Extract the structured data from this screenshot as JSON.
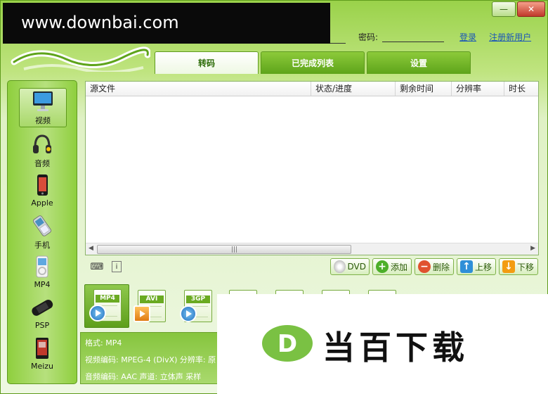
{
  "window": {
    "minimize_glyph": "—",
    "close_glyph": "✕"
  },
  "watermark": {
    "text": "www.downbai.com"
  },
  "login": {
    "password_label": "密码:",
    "login_link": "登录",
    "register_link": "注册新用户"
  },
  "tabs": [
    {
      "label": "转码",
      "active": true
    },
    {
      "label": "已完成列表",
      "active": false
    },
    {
      "label": "设置",
      "active": false
    }
  ],
  "sidebar": {
    "items": [
      {
        "label": "视频",
        "icon": "monitor-icon",
        "active": true
      },
      {
        "label": "音频",
        "icon": "headphones-icon"
      },
      {
        "label": "Apple",
        "icon": "iphone-icon"
      },
      {
        "label": "手机",
        "icon": "mobile-phone-icon"
      },
      {
        "label": "MP4",
        "icon": "mp4-player-icon"
      },
      {
        "label": "PSP",
        "icon": "psp-icon"
      },
      {
        "label": "Meizu",
        "icon": "meizu-player-icon"
      }
    ]
  },
  "table": {
    "columns": [
      "源文件",
      "状态/进度",
      "剩余时间",
      "分辨率",
      "时长"
    ],
    "rows": []
  },
  "scrollbar": {
    "left_arrow": "◀",
    "right_arrow": "▶",
    "grip": "|||"
  },
  "toolbar": {
    "dvd_label": "DVD",
    "add_label": "添加",
    "delete_label": "删除",
    "move_up_label": "上移",
    "move_down_label": "下移"
  },
  "formats": [
    {
      "label": "MP4",
      "active": true
    },
    {
      "label": "AVI"
    },
    {
      "label": "3GP"
    }
  ],
  "info": {
    "format": "格式: MP4",
    "video_line": "视频编码: MPEG-4 (DivX)    分辨率: 原",
    "audio_line": "音频编码: AAC    声道: 立体声    采样"
  },
  "brand": {
    "text": "当百下载",
    "logo_letter": "D"
  },
  "colors": {
    "accent": "#6aaa22",
    "link": "#1a56b8",
    "brand_green": "#7ac143"
  }
}
